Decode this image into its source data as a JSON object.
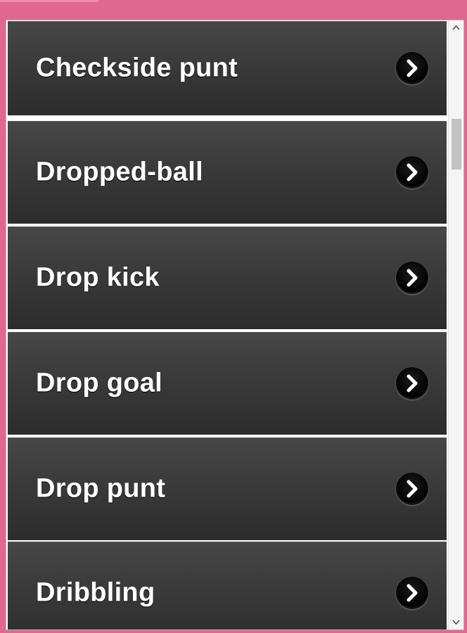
{
  "colors": {
    "frame": "#e06890",
    "item_background": "#3a3a3a",
    "item_text": "#ffffff",
    "arrow_button": "#000000"
  },
  "list": {
    "items": [
      {
        "label": "Checkside punt",
        "icon": "chevron-right-icon"
      },
      {
        "label": "Dropped-ball",
        "icon": "chevron-right-icon"
      },
      {
        "label": "Drop kick",
        "icon": "chevron-right-icon"
      },
      {
        "label": "Drop goal",
        "icon": "chevron-right-icon"
      },
      {
        "label": "Drop punt",
        "icon": "chevron-right-icon"
      },
      {
        "label": "Dribbling",
        "icon": "chevron-right-icon"
      }
    ]
  },
  "scrollbar": {
    "up_icon": "scroll-up-arrow-icon",
    "down_icon": "scroll-down-arrow-icon"
  }
}
